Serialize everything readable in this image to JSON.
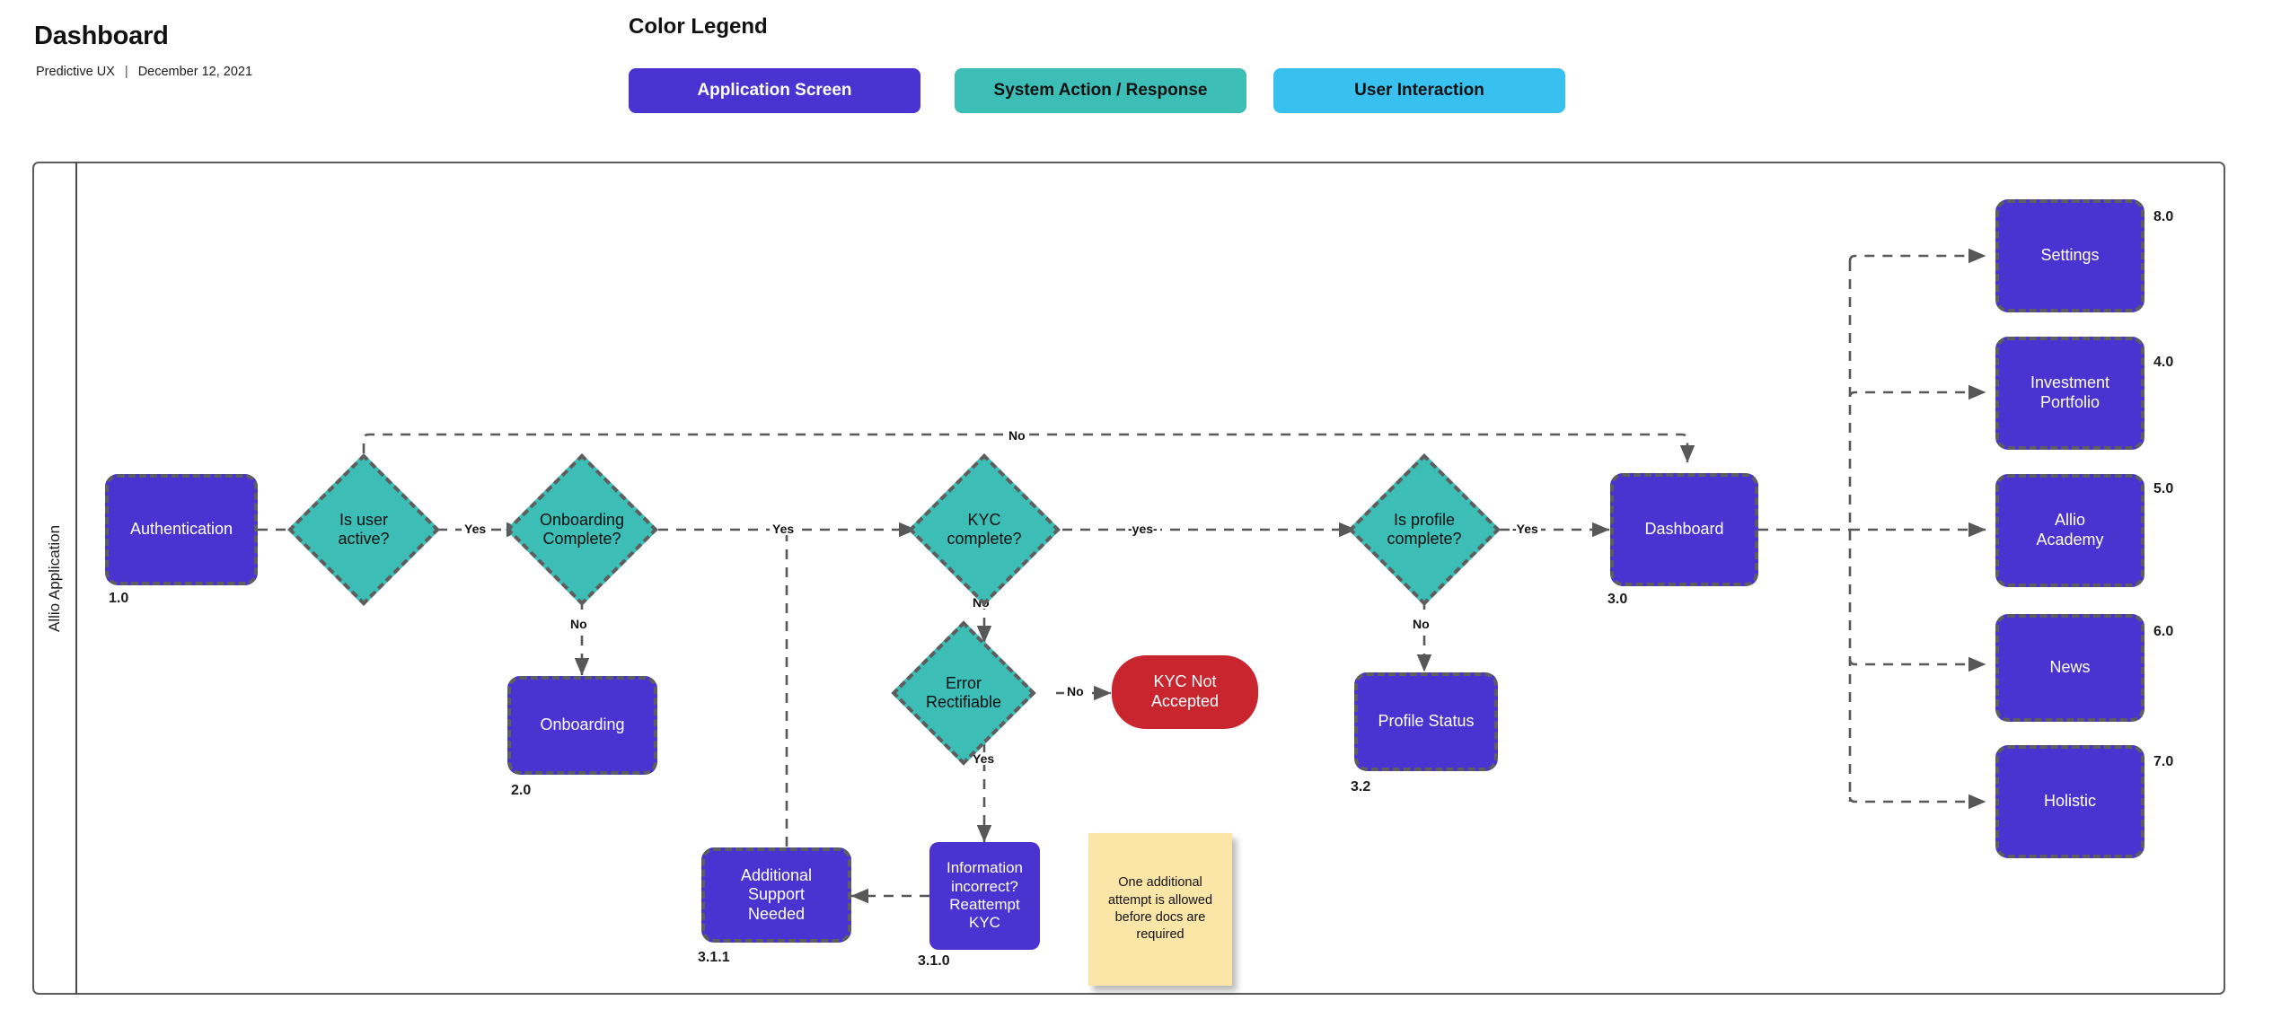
{
  "header": {
    "title": "Dashboard",
    "author": "Predictive UX",
    "separator": "|",
    "date": "December 12, 2021"
  },
  "legend": {
    "title": "Color Legend",
    "items": [
      {
        "label": "Application Screen",
        "color": "#4a33d0",
        "text_color": "#ffffff"
      },
      {
        "label": "System Action / Response",
        "color": "#3cbdb5",
        "text_color": "#111111"
      },
      {
        "label": "User Interaction",
        "color": "#38c0ef",
        "text_color": "#111111"
      }
    ]
  },
  "swimlane": {
    "label": "Allio Application"
  },
  "chart_data": {
    "type": "diagram",
    "title": "Dashboard",
    "nodes": [
      {
        "id": "authentication",
        "label": "Authentication",
        "number": "1.0",
        "shape": "screen"
      },
      {
        "id": "is-user-active",
        "label": "Is user\nactive?",
        "number": "",
        "shape": "decision"
      },
      {
        "id": "onboarding-complete",
        "label": "Onboarding\nComplete?",
        "number": "",
        "shape": "decision"
      },
      {
        "id": "onboarding",
        "label": "Onboarding",
        "number": "2.0",
        "shape": "screen"
      },
      {
        "id": "kyc-complete",
        "label": "KYC\ncomplete?",
        "number": "",
        "shape": "decision"
      },
      {
        "id": "error-rectifiable",
        "label": "Error\nRectifiable",
        "number": "",
        "shape": "decision"
      },
      {
        "id": "kyc-not-accepted",
        "label": "KYC Not\nAccepted",
        "number": "",
        "shape": "terminal"
      },
      {
        "id": "additional-support-needed",
        "label": "Additional\nSupport\nNeeded",
        "number": "3.1.1",
        "shape": "screen"
      },
      {
        "id": "information-incorrect",
        "label": "Information\nincorrect?\nReattempt\nKYC",
        "number": "3.1.0",
        "shape": "screen"
      },
      {
        "id": "is-profile-complete",
        "label": "Is profile\ncomplete?",
        "number": "",
        "shape": "decision"
      },
      {
        "id": "profile-status",
        "label": "Profile Status",
        "number": "3.2",
        "shape": "screen"
      },
      {
        "id": "dashboard",
        "label": "Dashboard",
        "number": "3.0",
        "shape": "screen"
      },
      {
        "id": "settings",
        "label": "Settings",
        "number": "8.0",
        "shape": "screen"
      },
      {
        "id": "investment-portfolio",
        "label": "Investment\nPortfolio",
        "number": "4.0",
        "shape": "screen"
      },
      {
        "id": "allio-academy",
        "label": "Allio\nAcademy",
        "number": "5.0",
        "shape": "screen"
      },
      {
        "id": "news",
        "label": "News",
        "number": "6.0",
        "shape": "screen"
      },
      {
        "id": "holistic",
        "label": "Holistic",
        "number": "7.0",
        "shape": "screen"
      }
    ],
    "edges": [
      {
        "from": "authentication",
        "to": "is-user-active",
        "label": ""
      },
      {
        "from": "is-user-active",
        "to": "onboarding-complete",
        "label": "Yes"
      },
      {
        "from": "is-user-active",
        "to": "dashboard",
        "label": "No"
      },
      {
        "from": "onboarding-complete",
        "to": "onboarding",
        "label": "No"
      },
      {
        "from": "onboarding-complete",
        "to": "kyc-complete",
        "label": "Yes"
      },
      {
        "from": "onboarding-complete",
        "to": "additional-support-needed",
        "label": ""
      },
      {
        "from": "kyc-complete",
        "to": "is-profile-complete",
        "label": "-yes-"
      },
      {
        "from": "kyc-complete",
        "to": "error-rectifiable",
        "label": "No"
      },
      {
        "from": "error-rectifiable",
        "to": "kyc-not-accepted",
        "label": "No"
      },
      {
        "from": "error-rectifiable",
        "to": "information-incorrect",
        "label": "Yes"
      },
      {
        "from": "information-incorrect",
        "to": "additional-support-needed",
        "label": ""
      },
      {
        "from": "is-profile-complete",
        "to": "dashboard",
        "label": "-Yes"
      },
      {
        "from": "is-profile-complete",
        "to": "profile-status",
        "label": "No"
      },
      {
        "from": "dashboard",
        "to": "settings",
        "label": ""
      },
      {
        "from": "dashboard",
        "to": "investment-portfolio",
        "label": ""
      },
      {
        "from": "dashboard",
        "to": "allio-academy",
        "label": ""
      },
      {
        "from": "dashboard",
        "to": "news",
        "label": ""
      },
      {
        "from": "dashboard",
        "to": "holistic",
        "label": ""
      }
    ],
    "notes": [
      {
        "id": "kyc-attempt-note",
        "text": "One additional attempt is allowed before docs are required"
      }
    ]
  },
  "nodes": {
    "authentication": {
      "label": "Authentication",
      "number": "1.0"
    },
    "is_user_active": {
      "line1": "Is user",
      "line2": "active?"
    },
    "onboarding_complete": {
      "line1": "Onboarding",
      "line2": "Complete?"
    },
    "onboarding": {
      "label": "Onboarding",
      "number": "2.0"
    },
    "kyc_complete": {
      "line1": "KYC",
      "line2": "complete?"
    },
    "error_rectifiable": {
      "line1": "Error",
      "line2": "Rectifiable"
    },
    "kyc_not_accepted": {
      "line1": "KYC Not",
      "line2": "Accepted"
    },
    "additional_support": {
      "line1": "Additional",
      "line2": "Support",
      "line3": "Needed",
      "number": "3.1.1"
    },
    "information_incorrect": {
      "line1": "Information",
      "line2": "incorrect?",
      "line3": "Reattempt",
      "line4": "KYC",
      "number": "3.1.0"
    },
    "is_profile_complete": {
      "line1": "Is profile",
      "line2": "complete?"
    },
    "profile_status": {
      "label": "Profile Status",
      "number": "3.2"
    },
    "dashboard": {
      "label": "Dashboard",
      "number": "3.0"
    },
    "settings": {
      "label": "Settings",
      "number": "8.0"
    },
    "investment_portfolio": {
      "line1": "Investment",
      "line2": "Portfolio",
      "number": "4.0"
    },
    "allio_academy": {
      "line1": "Allio",
      "line2": "Academy",
      "number": "5.0"
    },
    "news": {
      "label": "News",
      "number": "6.0"
    },
    "holistic": {
      "label": "Holistic",
      "number": "7.0"
    }
  },
  "note": {
    "line1": "One additional",
    "line2": "attempt is allowed",
    "line3": "before docs are",
    "line4": "required"
  },
  "edge_labels": {
    "user_active_yes": "Yes",
    "user_active_no": "No",
    "onboarding_no": "No",
    "onboarding_yes": "Yes",
    "kyc_yes": "-yes-",
    "kyc_no": "No",
    "error_no": "No",
    "error_yes": "Yes",
    "profile_yes": "-Yes",
    "profile_no": "No"
  },
  "colors": {
    "screen": "#4a33d0",
    "decision": "#3cbdb5",
    "interaction": "#38c0ef",
    "terminal": "#c9252f",
    "note": "#fbe6a8",
    "stroke": "#5e5e5e"
  }
}
